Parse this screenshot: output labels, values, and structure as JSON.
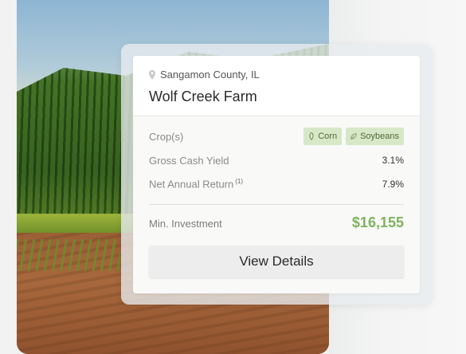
{
  "listing": {
    "location": "Sangamon County, IL",
    "name": "Wolf Creek Farm",
    "crops_label": "Crop(s)",
    "crops": [
      {
        "label": "Corn",
        "icon": "corn-icon"
      },
      {
        "label": "Soybeans",
        "icon": "leaf-icon"
      }
    ],
    "gross_yield_label": "Gross Cash Yield",
    "gross_yield_value": "3.1%",
    "net_return_label": "Net Annual Return",
    "net_return_footnote": "(1)",
    "net_return_value": "7.9%",
    "min_investment_label": "Min. Investment",
    "min_investment_value": "$16,155",
    "cta_label": "View Details"
  },
  "colors": {
    "accent_green": "#7fb35d",
    "tag_background": "#d7e8c8",
    "tag_text": "#4f6a3a"
  }
}
